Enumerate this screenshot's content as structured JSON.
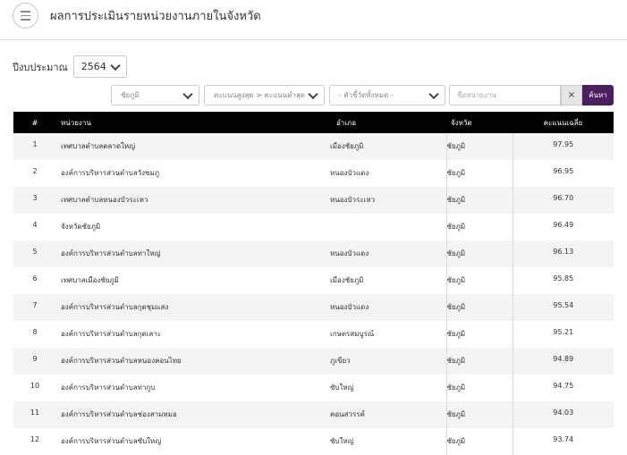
{
  "header": {
    "title": "ผลการประเมินรายหน่วยงานภายในจังหวัด",
    "menu_icon": "hamburger-icon"
  },
  "filters": {
    "year_label": "ปีงบประมาณ",
    "year_value": "2564",
    "province_value": "ชัยภูมิ",
    "sort_value": "คะแนนสูงสุด > คะแนนต่ำสุด",
    "indicator_value": "- ตัวชี้วัดทั้งหมด -",
    "search_placeholder": "ชื่อหน่วยงาน",
    "clear_label": "×",
    "search_label": "ค้นหา"
  },
  "table": {
    "columns": [
      "#",
      "หน่วยงาน",
      "อำเภอ",
      "จังหวัด",
      "คะแนนเฉลี่ย"
    ],
    "rows": [
      {
        "no": "1",
        "agency": "เทศบาลตำบลตลาดใหญ่",
        "district": "เมืองชัยภูมิ",
        "province": "ชัยภูมิ",
        "score": "97.95"
      },
      {
        "no": "2",
        "agency": "องค์การบริหารส่วนตำบลวังชมภู",
        "district": "หนองบัวแดง",
        "province": "ชัยภูมิ",
        "score": "96.95"
      },
      {
        "no": "3",
        "agency": "เทศบาลตำบลหนองบัวระเหว",
        "district": "หนองบัวระเหว",
        "province": "ชัยภูมิ",
        "score": "96.70"
      },
      {
        "no": "4",
        "agency": "จังหวัดชัยภูมิ",
        "district": "",
        "province": "ชัยภูมิ",
        "score": "96.49"
      },
      {
        "no": "5",
        "agency": "องค์การบริหารส่วนตำบลท่าใหญ่",
        "district": "หนองบัวแดง",
        "province": "ชัยภูมิ",
        "score": "96.13"
      },
      {
        "no": "6",
        "agency": "เทศบาลเมืองชัยภูมิ",
        "district": "เมืองชัยภูมิ",
        "province": "ชัยภูมิ",
        "score": "95.85"
      },
      {
        "no": "7",
        "agency": "องค์การบริหารส่วนตำบลกุดชุมแสง",
        "district": "หนองบัวแดง",
        "province": "ชัยภูมิ",
        "score": "95.54"
      },
      {
        "no": "8",
        "agency": "องค์การบริหารส่วนตำบลกุดเลาะ",
        "district": "เกษตรสมบูรณ์",
        "province": "ชัยภูมิ",
        "score": "95.21"
      },
      {
        "no": "9",
        "agency": "องค์การบริหารส่วนตำบลหนองคอนไทย",
        "district": "ภูเขียว",
        "province": "ชัยภูมิ",
        "score": "94.89"
      },
      {
        "no": "10",
        "agency": "องค์การบริหารส่วนตำบลท่ากูบ",
        "district": "ซับใหญ่",
        "province": "ชัยภูมิ",
        "score": "94.75"
      },
      {
        "no": "11",
        "agency": "องค์การบริหารส่วนตำบลช่องสามหมอ",
        "district": "คอนสวรรค์",
        "province": "ชัยภูมิ",
        "score": "94.03"
      },
      {
        "no": "12",
        "agency": "องค์การบริหารส่วนตำบลซับใหญ่",
        "district": "ซับใหญ่",
        "province": "ชัยภูมิ",
        "score": "93.74"
      }
    ]
  }
}
